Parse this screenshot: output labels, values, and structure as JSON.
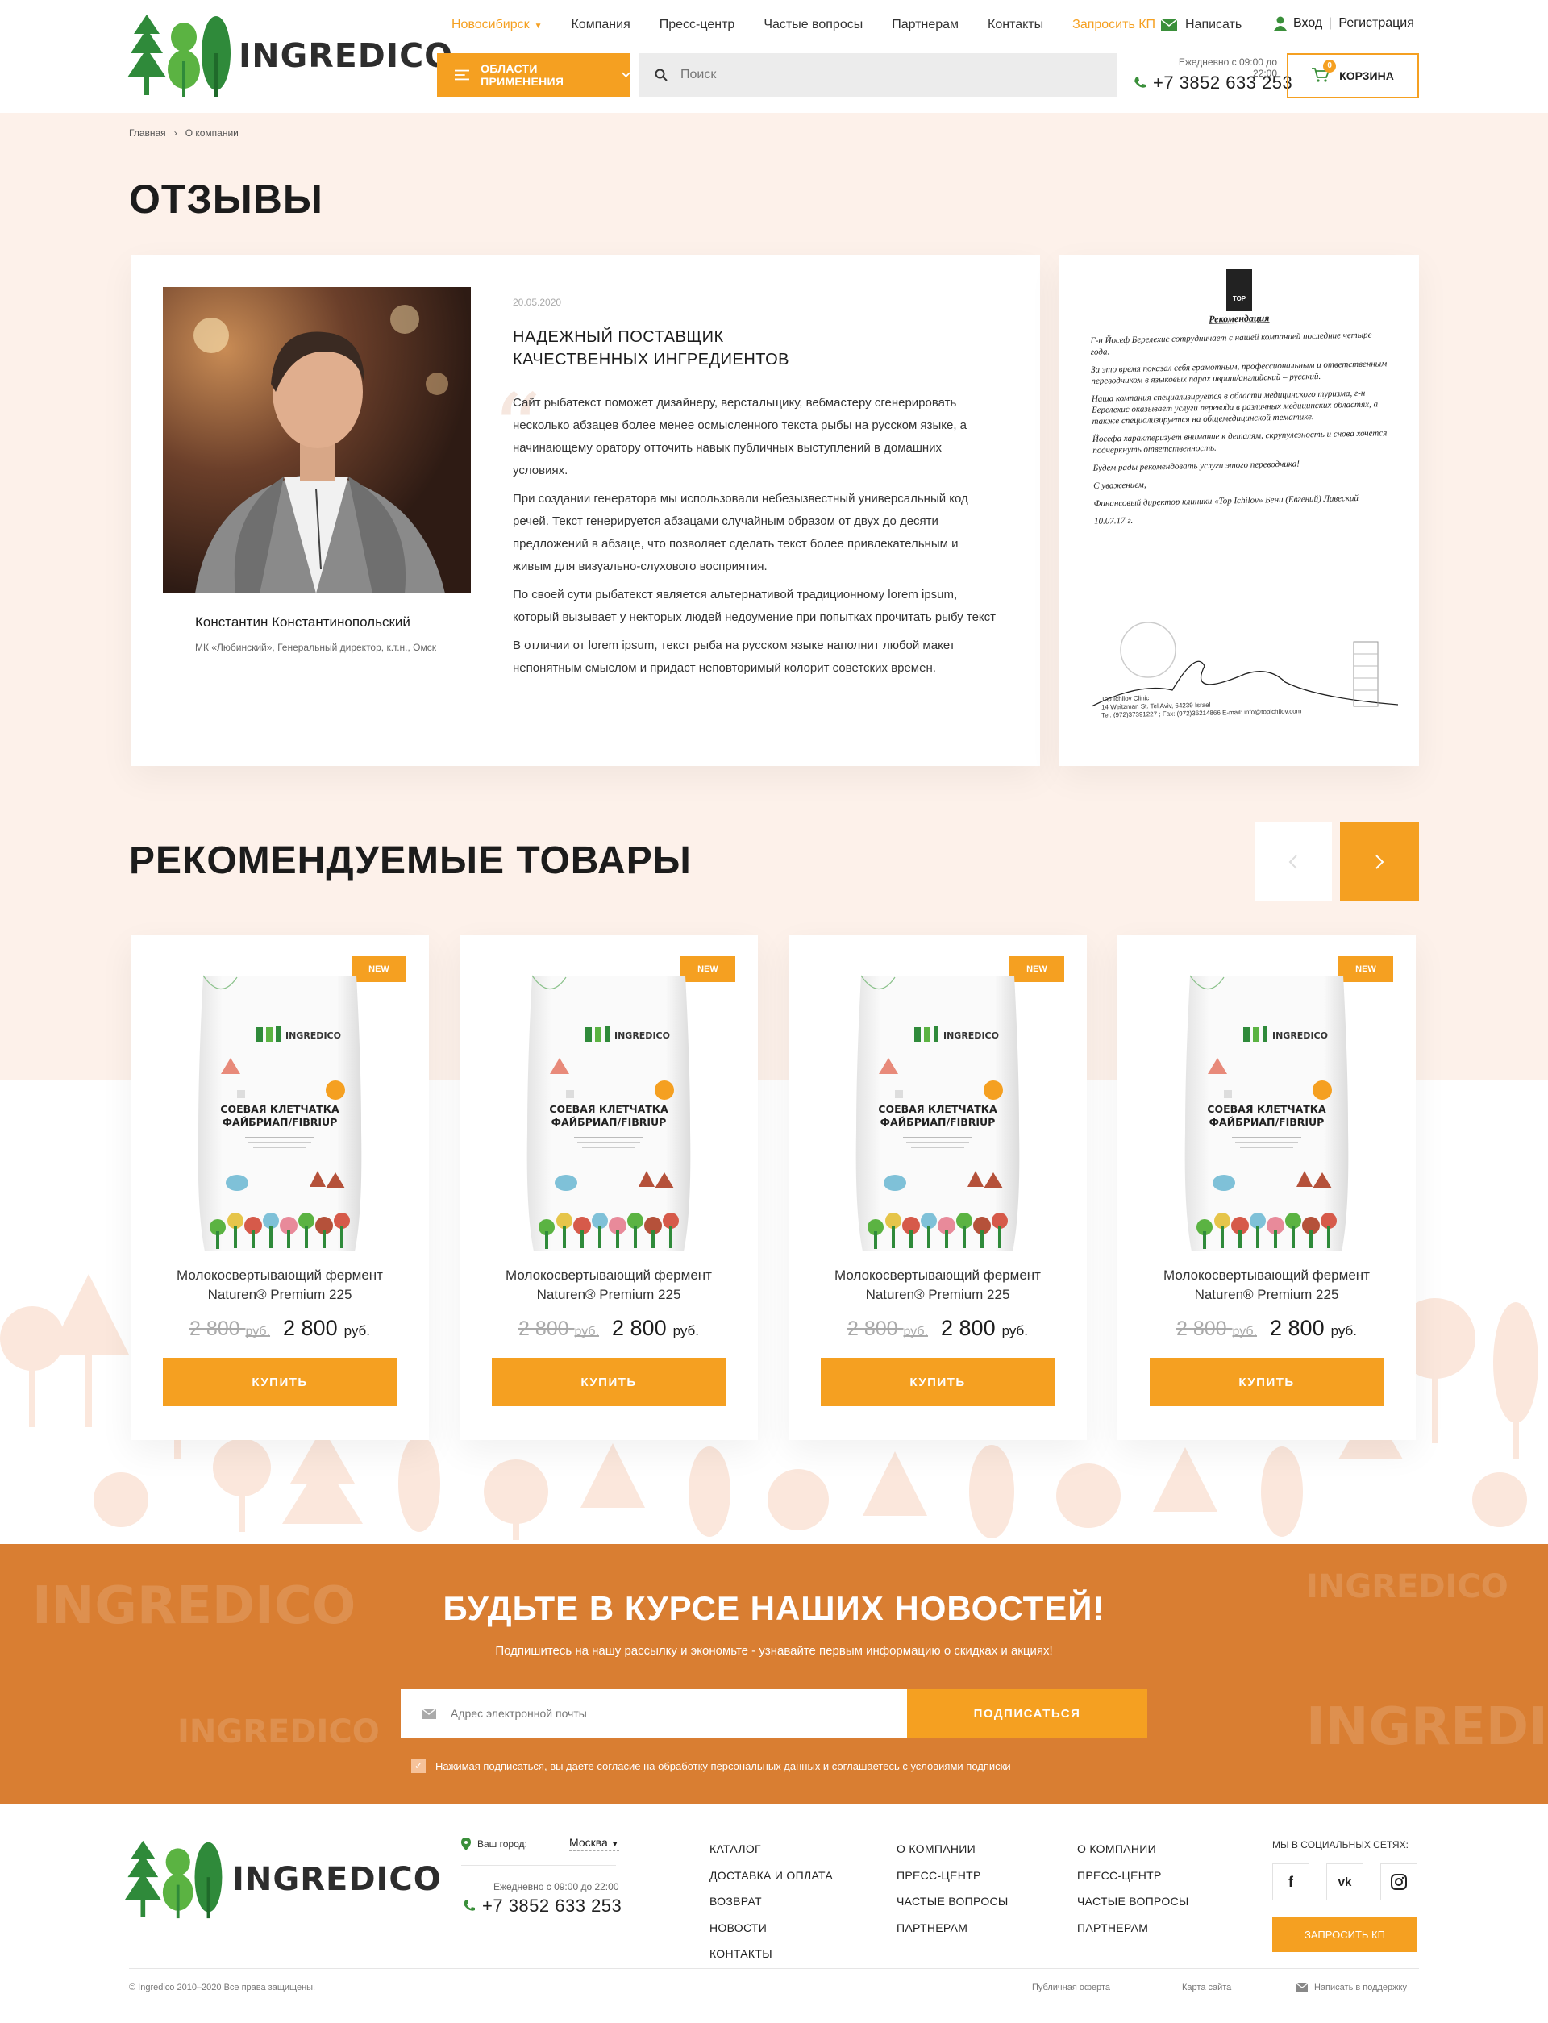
{
  "header": {
    "logo_text": "INGREDICO",
    "nav": {
      "city": "Новосибирск",
      "items": [
        "Компания",
        "Пресс-центр",
        "Частые вопросы",
        "Партнерам",
        "Контакты"
      ],
      "request_kp": "Запросить КП"
    },
    "write": "Написать",
    "login": "Вход",
    "register": "Регистрация",
    "catalog_button": "ОБЛАСТИ ПРИМЕНЕНИЯ",
    "search_placeholder": "Поиск",
    "hours": "Ежедневно с 09:00 до 22:00",
    "phone": "+7 3852 633 253",
    "cart_label": "КОРЗИНА",
    "cart_count": "0"
  },
  "breadcrumb": [
    "Главная",
    "О компании"
  ],
  "page_title": "ОТЗЫВЫ",
  "review": {
    "date": "20.05.2020",
    "title_line1": "НАДЕЖНЫЙ ПОСТАВЩИК",
    "title_line2": "КАЧЕСТВЕННЫХ ИНГРЕДИЕНТОВ",
    "paragraphs": [
      "Сайт рыбатекст поможет дизайнеру, верстальщику, вебмастеру сгенерировать несколько абзацев более менее осмысленного текста рыбы на русском языке, а начинающему оратору отточить навык публичных выступлений в домашних условиях.",
      "При создании генератора мы использовали небезызвестный универсальный код речей. Текст генерируется абзацами случайным образом от двух до десяти предложений в абзаце, что позволяет сделать текст более привлекательным и живым для визуально-слухового восприятия.",
      "По своей сути рыбатекст является альтернативой традиционному lorem ipsum, который вызывает у некторых людей недоумение при попытках прочитать рыбу текст",
      " В отличии от lorem ipsum, текст рыба на русском языке наполнит любой макет непонятным смыслом и придаст неповторимый колорит советских времен."
    ],
    "author_name": "Константин Константинопольский",
    "author_role": "МК «Любинский», Генеральный директор, к.т.н., Омск"
  },
  "letter": {
    "logo": "TOP",
    "title": "Рекомендация",
    "paragraphs": [
      "Г-н Йосеф Берелехис сотрудничает с нашей компанией последние четыре года.",
      "За это время показал себя грамотным, профессиональным и ответственным переводчиком в языковых парах иврит/английский – русский.",
      "Наша компания специализируется в области медицинского туризма, г-н Берелехис оказывает услуги перевода в различных медицинских областях, а также специализируется на общемедицинской тематике.",
      "Йосефа характеризует внимание к деталям, скрупулезность и снова хочется подчеркнуть ответственность.",
      "Будем рады рекомендовать услуги этого переводчика!",
      "С уважением,",
      "Финансовый директор клиники «Top Ichilov» Бени (Евгений) Лавеский",
      "10.07.17 г."
    ],
    "address_1": "Top Ichilov Clinic",
    "address_2": "14 Weitzman St. Tel Aviv, 64239 Israel",
    "address_3": "Tel: (972)37391227 ; Fax: (972)36214866 E-mail: info@topichilov.com"
  },
  "recommended": {
    "title": "РЕКОМЕНДУЕМЫЕ ТОВАРЫ",
    "products": [
      {
        "badge": "NEW",
        "pack_brand": "INGREDICO",
        "pack_line1": "СОЕВАЯ КЛЕТЧАТКА",
        "pack_line2": "ФАЙБРИАП/FIBRIUP",
        "name_line1": "Молокосвертывающий фермент",
        "name_line2": "Naturen® Premium 225",
        "old_price": "2 800",
        "old_currency": "руб.",
        "price": "2 800",
        "currency": "руб.",
        "buy": "КУПИТЬ"
      },
      {
        "badge": "NEW",
        "pack_brand": "INGREDICO",
        "pack_line1": "СОЕВАЯ КЛЕТЧАТКА",
        "pack_line2": "ФАЙБРИАП/FIBRIUP",
        "name_line1": "Молокосвертывающий фермент",
        "name_line2": "Naturen® Premium 225",
        "old_price": "2 800",
        "old_currency": "руб.",
        "price": "2 800",
        "currency": "руб.",
        "buy": "КУПИТЬ"
      },
      {
        "badge": "NEW",
        "pack_brand": "INGREDICO",
        "pack_line1": "СОЕВАЯ КЛЕТЧАТКА",
        "pack_line2": "ФАЙБРИАП/FIBRIUP",
        "name_line1": "Молокосвертывающий фермент",
        "name_line2": "Naturen® Premium 225",
        "old_price": "2 800",
        "old_currency": "руб.",
        "price": "2 800",
        "currency": "руб.",
        "buy": "КУПИТЬ"
      },
      {
        "badge": "NEW",
        "pack_brand": "INGREDICO",
        "pack_line1": "СОЕВАЯ КЛЕТЧАТКА",
        "pack_line2": "ФАЙБРИАП/FIBRIUP",
        "name_line1": "Молокосвертывающий фермент",
        "name_line2": "Naturen® Premium 225",
        "old_price": "2 800",
        "old_currency": "руб.",
        "price": "2 800",
        "currency": "руб.",
        "buy": "КУПИТЬ"
      }
    ]
  },
  "newsletter": {
    "title": "БУДЬТЕ В КУРСЕ НАШИХ НОВОСТЕЙ!",
    "subtitle": "Подпишитесь на нашу рассылку и экономьте - узнавайте первым информацию о скидках и акциях!",
    "email_placeholder": "Адрес электронной почты",
    "subscribe": "ПОДПИСАТЬСЯ",
    "consent": "Нажимая подписаться, вы даете согласие на обработку персональных данных и соглашаетесь с условиями подписки",
    "consent_checked": true
  },
  "footer": {
    "logo_text": "INGREDICO",
    "city_label": "Ваш город:",
    "city": "Москва",
    "hours": "Ежедневно с 09:00 до 22:00",
    "phone": "+7 3852 633 253",
    "col1": [
      "КАТАЛОГ",
      "ДОСТАВКА И ОПЛАТА",
      "ВОЗВРАТ",
      "НОВОСТИ",
      "КОНТАКТЫ"
    ],
    "col2": [
      "О КОМПАНИИ",
      "ПРЕСС-ЦЕНТР",
      "ЧАСТЫЕ ВОПРОСЫ",
      "ПАРТНЕРАМ"
    ],
    "col3": [
      "О КОМПАНИИ",
      "ПРЕСС-ЦЕНТР",
      "ЧАСТЫЕ ВОПРОСЫ",
      "ПАРТНЕРАМ"
    ],
    "social_title": "МЫ В СОЦИАЛЬНЫХ СЕТЯХ:",
    "social": [
      "f",
      "vk",
      "instagram"
    ],
    "request_kp": "ЗАПРОСИТЬ КП",
    "copyright": "© Ingredico 2010–2020 Все права защищены.",
    "offer": "Публичная оферта",
    "sitemap": "Карта сайта",
    "support": "Написать в поддержку"
  },
  "colors": {
    "accent": "#f5a021",
    "newsletter_bg": "#d97e32",
    "beige_bg": "#fdf1ea",
    "logo_green": "#3a8f3a"
  }
}
